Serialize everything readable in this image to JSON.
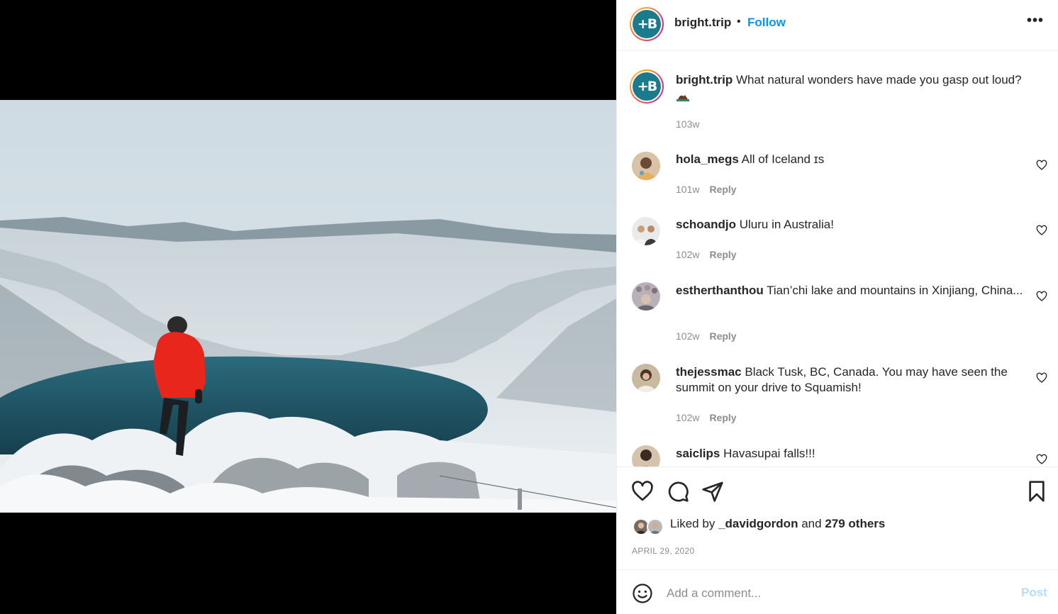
{
  "post": {
    "username": "bright.trip",
    "follow_label": "Follow",
    "separator": "•",
    "more_label": "•••",
    "avatar_text": "+B",
    "brand_color": "#1b7a8c",
    "caption": {
      "username": "bright.trip",
      "text": "What natural wonders have made you gasp out loud?",
      "emoji_icon": "mountain-emoji-icon",
      "time": "103w"
    }
  },
  "comments": [
    {
      "username": "hola_megs",
      "text": "All of Iceland ɪs",
      "time": "101w",
      "reply_label": "Reply"
    },
    {
      "username": "schoandjo",
      "text": "Uluru in Australia!",
      "time": "102w",
      "reply_label": "Reply"
    },
    {
      "username": "estherthanthou",
      "text": "Tian’chi lake and mountains in Xinjiang, China...",
      "time": "102w",
      "reply_label": "Reply"
    },
    {
      "username": "thejessmac",
      "text": "Black Tusk, BC, Canada. You may have seen the summit on your drive to Squamish!",
      "time": "102w",
      "reply_label": "Reply"
    },
    {
      "username": "saiclips",
      "text": "Havasupai falls!!!",
      "time": "",
      "reply_label": ""
    }
  ],
  "actions": {
    "like_icon": "heart-icon",
    "comment_icon": "comment-icon",
    "share_icon": "paper-plane-icon",
    "save_icon": "bookmark-icon"
  },
  "likes": {
    "prefix": "Liked by",
    "user": "_davidgordon",
    "middle": "and",
    "others": "279 others"
  },
  "date": "APRIL 29, 2020",
  "add_comment": {
    "placeholder": "Add a comment...",
    "post_label": "Post",
    "post_color": "#b2dffc"
  }
}
